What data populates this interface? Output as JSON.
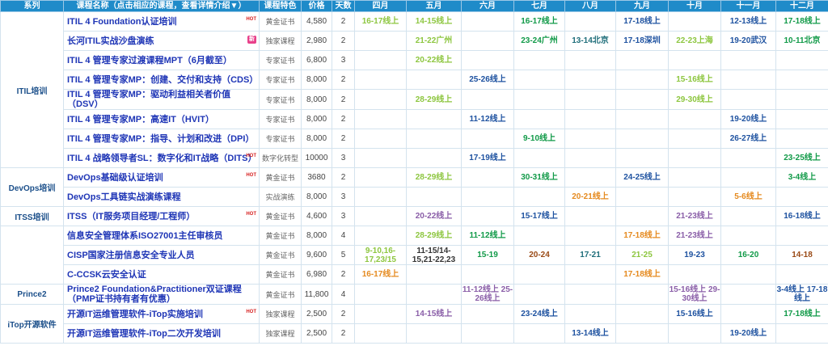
{
  "headers": [
    "系列",
    "课程名称（点击相应的课程，查看详情介绍▼）",
    "课程特色",
    "价格",
    "天数",
    "四月",
    "五月",
    "六月",
    "七月",
    "八月",
    "九月",
    "十月",
    "十一月",
    "十二月"
  ],
  "categories": [
    {
      "name": "ITIL培训",
      "start": 0,
      "span": 8
    },
    {
      "name": "DevOps培训",
      "start": 8,
      "span": 2
    },
    {
      "name": "ITSS培训",
      "start": 10,
      "span": 1
    },
    {
      "name": "",
      "start": 11,
      "span": 3
    },
    {
      "name": "Prince2",
      "start": 14,
      "span": 1
    },
    {
      "name": "iTop开源软件",
      "start": 15,
      "span": 2
    }
  ],
  "badges": {
    "hot": "HOT",
    "new": "新"
  },
  "rows": [
    {
      "name": "ITIL 4 Foundation认证培训",
      "badge": "hot",
      "feature": "黄金证书",
      "price": "4,580",
      "days": "2",
      "months": [
        {
          "t": "16-17线上",
          "c": "lgreen"
        },
        {
          "t": "14-15线上",
          "c": "lgreen"
        },
        {
          "t": "",
          "c": ""
        },
        {
          "t": "16-17线上",
          "c": "dgreen"
        },
        {
          "t": "",
          "c": ""
        },
        {
          "t": "17-18线上",
          "c": "blue"
        },
        {
          "t": "",
          "c": ""
        },
        {
          "t": "12-13线上",
          "c": "blue"
        },
        {
          "t": "17-18线上",
          "c": "dgreen"
        }
      ]
    },
    {
      "name": "长河ITIL实战沙盘演练",
      "badge": "new",
      "feature": "独家课程",
      "price": "2,980",
      "days": "2",
      "months": [
        {
          "t": "",
          "c": ""
        },
        {
          "t": "21-22广州",
          "c": "lgreen"
        },
        {
          "t": "",
          "c": ""
        },
        {
          "t": "23-24广州",
          "c": "dgreen"
        },
        {
          "t": "13-14北京",
          "c": "teal"
        },
        {
          "t": "17-18深圳",
          "c": "blue"
        },
        {
          "t": "22-23上海",
          "c": "lgreen"
        },
        {
          "t": "19-20武汉",
          "c": "blue"
        },
        {
          "t": "10-11北京",
          "c": "dgreen"
        }
      ]
    },
    {
      "name": "ITIL 4 管理专家过渡课程MPT（6月截至）",
      "badge": "",
      "feature": "专家证书",
      "price": "6,800",
      "days": "3",
      "months": [
        {
          "t": "",
          "c": ""
        },
        {
          "t": "20-22线上",
          "c": "lgreen"
        },
        {
          "t": "",
          "c": ""
        },
        {
          "t": "",
          "c": ""
        },
        {
          "t": "",
          "c": ""
        },
        {
          "t": "",
          "c": ""
        },
        {
          "t": "",
          "c": ""
        },
        {
          "t": "",
          "c": ""
        },
        {
          "t": "",
          "c": ""
        }
      ]
    },
    {
      "name": "ITIL 4 管理专家MP：创建、交付和支持（CDS）",
      "badge": "",
      "feature": "专家证书",
      "price": "8,000",
      "days": "2",
      "months": [
        {
          "t": "",
          "c": ""
        },
        {
          "t": "",
          "c": ""
        },
        {
          "t": "25-26线上",
          "c": "blue"
        },
        {
          "t": "",
          "c": ""
        },
        {
          "t": "",
          "c": ""
        },
        {
          "t": "",
          "c": ""
        },
        {
          "t": "15-16线上",
          "c": "lgreen"
        },
        {
          "t": "",
          "c": ""
        },
        {
          "t": "",
          "c": ""
        }
      ]
    },
    {
      "name": "ITIL 4 管理专家MP：驱动利益相关者价值（DSV）",
      "badge": "",
      "feature": "专家证书",
      "price": "8,000",
      "days": "2",
      "months": [
        {
          "t": "",
          "c": ""
        },
        {
          "t": "28-29线上",
          "c": "lgreen"
        },
        {
          "t": "",
          "c": ""
        },
        {
          "t": "",
          "c": ""
        },
        {
          "t": "",
          "c": ""
        },
        {
          "t": "",
          "c": ""
        },
        {
          "t": "29-30线上",
          "c": "lgreen"
        },
        {
          "t": "",
          "c": ""
        },
        {
          "t": "",
          "c": ""
        }
      ]
    },
    {
      "name": "ITIL 4 管理专家MP：高速IT（HVIT）",
      "badge": "",
      "feature": "专家证书",
      "price": "8,000",
      "days": "2",
      "months": [
        {
          "t": "",
          "c": ""
        },
        {
          "t": "",
          "c": ""
        },
        {
          "t": "11-12线上",
          "c": "blue"
        },
        {
          "t": "",
          "c": ""
        },
        {
          "t": "",
          "c": ""
        },
        {
          "t": "",
          "c": ""
        },
        {
          "t": "",
          "c": ""
        },
        {
          "t": "19-20线上",
          "c": "blue"
        },
        {
          "t": "",
          "c": ""
        }
      ]
    },
    {
      "name": "ITIL 4 管理专家MP：指导、计划和改进（DPI）",
      "badge": "",
      "feature": "专家证书",
      "price": "8,000",
      "days": "2",
      "months": [
        {
          "t": "",
          "c": ""
        },
        {
          "t": "",
          "c": ""
        },
        {
          "t": "",
          "c": ""
        },
        {
          "t": "9-10线上",
          "c": "dgreen"
        },
        {
          "t": "",
          "c": ""
        },
        {
          "t": "",
          "c": ""
        },
        {
          "t": "",
          "c": ""
        },
        {
          "t": "26-27线上",
          "c": "blue"
        },
        {
          "t": "",
          "c": ""
        }
      ]
    },
    {
      "name": "ITIL 4 战略领导者SL：数字化和IT战略（DITS）",
      "badge": "hot",
      "feature": "数字化转型",
      "price": "10000",
      "days": "3",
      "months": [
        {
          "t": "",
          "c": ""
        },
        {
          "t": "",
          "c": ""
        },
        {
          "t": "17-19线上",
          "c": "blue"
        },
        {
          "t": "",
          "c": ""
        },
        {
          "t": "",
          "c": ""
        },
        {
          "t": "",
          "c": ""
        },
        {
          "t": "",
          "c": ""
        },
        {
          "t": "",
          "c": ""
        },
        {
          "t": "23-25线上",
          "c": "dgreen"
        }
      ]
    },
    {
      "name": "DevOps基础级认证培训",
      "badge": "hot",
      "feature": "黄金证书",
      "price": "3680",
      "days": "2",
      "months": [
        {
          "t": "",
          "c": ""
        },
        {
          "t": "28-29线上",
          "c": "lgreen"
        },
        {
          "t": "",
          "c": ""
        },
        {
          "t": "30-31线上",
          "c": "dgreen"
        },
        {
          "t": "",
          "c": ""
        },
        {
          "t": "24-25线上",
          "c": "blue"
        },
        {
          "t": "",
          "c": ""
        },
        {
          "t": "",
          "c": ""
        },
        {
          "t": "3-4线上",
          "c": "dgreen"
        }
      ]
    },
    {
      "name": "DevOps工具链实战演练课程",
      "badge": "",
      "feature": "实战演练",
      "price": "8,000",
      "days": "3",
      "months": [
        {
          "t": "",
          "c": ""
        },
        {
          "t": "",
          "c": ""
        },
        {
          "t": "",
          "c": ""
        },
        {
          "t": "",
          "c": ""
        },
        {
          "t": "20-21线上",
          "c": "orange"
        },
        {
          "t": "",
          "c": ""
        },
        {
          "t": "",
          "c": ""
        },
        {
          "t": "5-6线上",
          "c": "orange"
        },
        {
          "t": "",
          "c": ""
        }
      ]
    },
    {
      "name": "ITSS（IT服务项目经理/工程师）",
      "badge": "hot",
      "feature": "黄金证书",
      "price": "4,600",
      "days": "3",
      "months": [
        {
          "t": "",
          "c": ""
        },
        {
          "t": "20-22线上",
          "c": "purple"
        },
        {
          "t": "",
          "c": ""
        },
        {
          "t": "15-17线上",
          "c": "blue"
        },
        {
          "t": "",
          "c": ""
        },
        {
          "t": "",
          "c": ""
        },
        {
          "t": "21-23线上",
          "c": "purple"
        },
        {
          "t": "",
          "c": ""
        },
        {
          "t": "16-18线上",
          "c": "blue"
        }
      ]
    },
    {
      "name": "信息安全管理体系ISO27001主任审核员",
      "badge": "",
      "feature": "黄金证书",
      "price": "8,000",
      "days": "4",
      "months": [
        {
          "t": "",
          "c": ""
        },
        {
          "t": "28-29线上",
          "c": "lgreen"
        },
        {
          "t": "11-12线上",
          "c": "dgreen"
        },
        {
          "t": "",
          "c": ""
        },
        {
          "t": "",
          "c": ""
        },
        {
          "t": "17-18线上",
          "c": "orange"
        },
        {
          "t": "21-23线上",
          "c": "purple"
        },
        {
          "t": "",
          "c": ""
        },
        {
          "t": "",
          "c": ""
        }
      ]
    },
    {
      "name": "CISP国家注册信息安全专业人员",
      "badge": "",
      "feature": "黄金证书",
      "price": "9,600",
      "days": "5",
      "months": [
        {
          "t": "9-10,16-17,23/15",
          "c": "lgreen"
        },
        {
          "t": "11-15/14-15,21-22,23",
          "c": "dark"
        },
        {
          "t": "15-19",
          "c": "dgreen"
        },
        {
          "t": "20-24",
          "c": "brown"
        },
        {
          "t": "17-21",
          "c": "teal"
        },
        {
          "t": "21-25",
          "c": "lgreen"
        },
        {
          "t": "19-23",
          "c": "blue"
        },
        {
          "t": "16-20",
          "c": "dgreen"
        },
        {
          "t": "14-18",
          "c": "brown"
        }
      ]
    },
    {
      "name": "C-CCSK云安全认证",
      "badge": "",
      "feature": "黄金证书",
      "price": "6,980",
      "days": "2",
      "months": [
        {
          "t": "16-17线上",
          "c": "orange"
        },
        {
          "t": "",
          "c": ""
        },
        {
          "t": "",
          "c": ""
        },
        {
          "t": "",
          "c": ""
        },
        {
          "t": "",
          "c": ""
        },
        {
          "t": "17-18线上",
          "c": "orange"
        },
        {
          "t": "",
          "c": ""
        },
        {
          "t": "",
          "c": ""
        },
        {
          "t": "",
          "c": ""
        }
      ]
    },
    {
      "name": "Prince2 Foundation&Practitioner双证课程（PMP证书持有者有优惠）",
      "badge": "",
      "feature": "黄金证书",
      "price": "11,800",
      "days": "4",
      "months": [
        {
          "t": "",
          "c": ""
        },
        {
          "t": "",
          "c": ""
        },
        {
          "t": "11-12线上 25-26线上",
          "c": "purple"
        },
        {
          "t": "",
          "c": ""
        },
        {
          "t": "",
          "c": ""
        },
        {
          "t": "",
          "c": ""
        },
        {
          "t": "15-16线上 29-30线上",
          "c": "purple"
        },
        {
          "t": "",
          "c": ""
        },
        {
          "t": "3-4线上 17-18线上",
          "c": "blue"
        }
      ]
    },
    {
      "name": "开源IT运维管理软件-iTop实施培训",
      "badge": "hot",
      "feature": "独家课程",
      "price": "2,500",
      "days": "2",
      "months": [
        {
          "t": "",
          "c": ""
        },
        {
          "t": "14-15线上",
          "c": "purple"
        },
        {
          "t": "",
          "c": ""
        },
        {
          "t": "23-24线上",
          "c": "blue"
        },
        {
          "t": "",
          "c": ""
        },
        {
          "t": "",
          "c": ""
        },
        {
          "t": "15-16线上",
          "c": "blue"
        },
        {
          "t": "",
          "c": ""
        },
        {
          "t": "17-18线上",
          "c": "dgreen"
        }
      ]
    },
    {
      "name": "开源IT运维管理软件-iTop二次开发培训",
      "badge": "",
      "feature": "独家课程",
      "price": "2,500",
      "days": "2",
      "months": [
        {
          "t": "",
          "c": ""
        },
        {
          "t": "",
          "c": ""
        },
        {
          "t": "",
          "c": ""
        },
        {
          "t": "",
          "c": ""
        },
        {
          "t": "13-14线上",
          "c": "blue"
        },
        {
          "t": "",
          "c": ""
        },
        {
          "t": "",
          "c": ""
        },
        {
          "t": "19-20线上",
          "c": "blue"
        },
        {
          "t": "",
          "c": ""
        }
      ]
    }
  ]
}
